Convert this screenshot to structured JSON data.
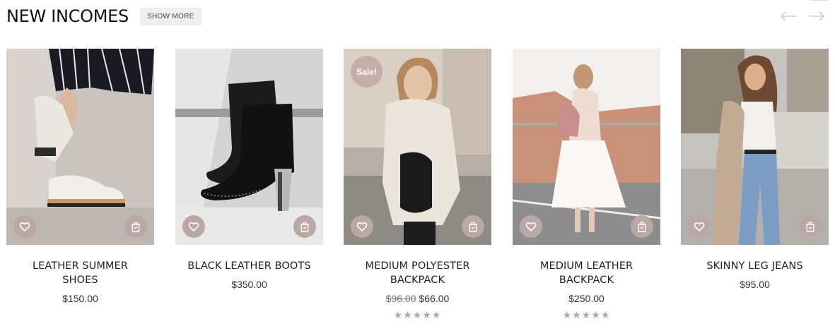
{
  "section": {
    "title": "NEW INCOMES",
    "show_more_label": "SHOW MORE"
  },
  "nav": {
    "prev_icon": "arrow-left-icon",
    "next_icon": "arrow-right-icon"
  },
  "colors": {
    "accent": "#bba7a4",
    "sale": "#c4aeaa",
    "star": "#bba7a4",
    "arrow": "#cfcfcf"
  },
  "products": [
    {
      "name": "LEATHER SUMMER SHOES",
      "price": "$150.00",
      "old_price": "",
      "sale_label": "",
      "rating": 0
    },
    {
      "name": "BLACK LEATHER BOOTS",
      "price": "$350.00",
      "old_price": "",
      "sale_label": "",
      "rating": 0
    },
    {
      "name": "MEDIUM POLYESTER BACKPACK",
      "price": "$66.00",
      "old_price": "$96.00",
      "sale_label": "Sale!",
      "rating": 5
    },
    {
      "name": "MEDIUM LEATHER BACKPACK",
      "price": "$250.00",
      "old_price": "",
      "sale_label": "",
      "rating": 5
    },
    {
      "name": "SKINNY LEG JEANS",
      "price": "$95.00",
      "old_price": "",
      "sale_label": "",
      "rating": 0
    }
  ]
}
